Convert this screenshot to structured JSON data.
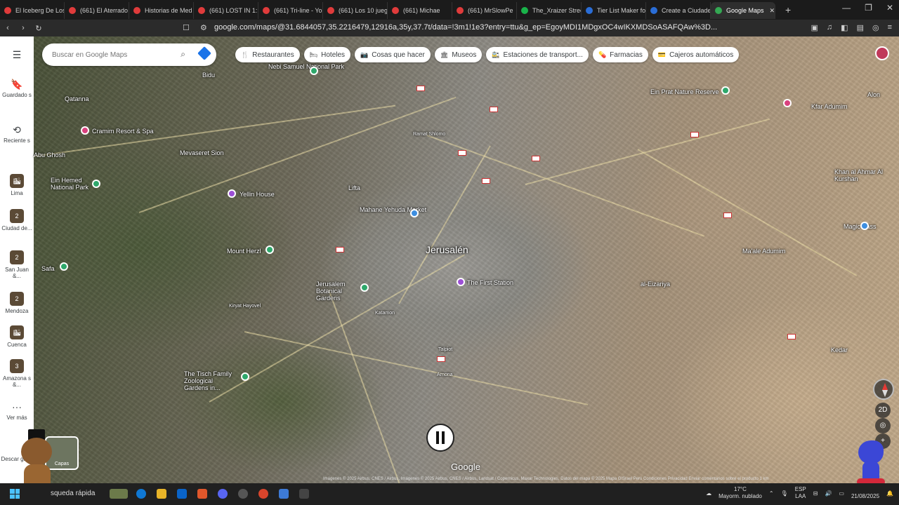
{
  "browser": {
    "tabs": [
      {
        "label": "El Iceberg De Los",
        "color": "#e03b3b"
      },
      {
        "label": "(661) El Aterrado",
        "color": "#e03b3b"
      },
      {
        "label": "Historias de Med",
        "color": "#e03b3b"
      },
      {
        "label": "(661) LOST IN 1:",
        "color": "#e03b3b"
      },
      {
        "label": "(661) Tri-line - Yo",
        "color": "#e03b3b"
      },
      {
        "label": "(661) Los 10 juegc",
        "color": "#e03b3b"
      },
      {
        "label": "(661) Michae",
        "color": "#e03b3b"
      },
      {
        "label": "(661) MrSlowPe",
        "color": "#e03b3b"
      },
      {
        "label": "The_Xraizer Stree",
        "color": "#19b34a"
      },
      {
        "label": "Tier List Maker fo",
        "color": "#2a6dd6"
      },
      {
        "label": "Create a Ciudade",
        "color": "#2a6dd6"
      },
      {
        "label": "Google Maps",
        "color": "#34a853",
        "active": true
      }
    ],
    "new_tab": "+",
    "close_glyph": "✕",
    "window_controls": [
      "—",
      "❐",
      "✕"
    ],
    "url": "google.com/maps/@31.6844057,35.2216479,12916a,35y,37.7t/data=!3m1!1e3?entry=ttu&g_ep=EgoyMDI1MDgxOC4wIKXMDSoASAFQAw%3D...",
    "nav": {
      "back": "‹",
      "forward": "›",
      "reload": "↻"
    }
  },
  "rail": {
    "menu_icon": "☰",
    "items": [
      {
        "glyph": "🔖",
        "label": "Guardado s"
      },
      {
        "glyph": "⟲",
        "label": "Reciente s"
      },
      {
        "thumb": "🏙",
        "label": "Lima"
      },
      {
        "thumb": "2",
        "label": "Ciudad de..."
      },
      {
        "thumb": "2",
        "label": "San Juan &..."
      },
      {
        "thumb": "2",
        "label": "Mendoza"
      },
      {
        "thumb": "🏙",
        "label": "Cuenca"
      },
      {
        "thumb": "3",
        "label": "Amazona s &..."
      },
      {
        "glyph": "···",
        "label": "Ver más"
      },
      {
        "label": "Descar ga la"
      }
    ]
  },
  "search": {
    "placeholder": "Buscar en Google Maps"
  },
  "chips": [
    {
      "icon": "🍴",
      "label": "Restaurantes"
    },
    {
      "icon": "🛏",
      "label": "Hoteles"
    },
    {
      "icon": "📷",
      "label": "Cosas que hacer"
    },
    {
      "icon": "🏛",
      "label": "Museos"
    },
    {
      "icon": "🚉",
      "label": "Estaciones de transport..."
    },
    {
      "icon": "💊",
      "label": "Farmacias"
    },
    {
      "icon": "💳",
      "label": "Cajeros automáticos"
    }
  ],
  "map": {
    "city": "Jerusalén",
    "places": [
      "Bidu",
      "Qatanna",
      "Cramim Resort & Spa",
      "Mevaseret Sion",
      "Ein Hemed National Park",
      "Yellin House",
      "Lifta",
      "Mahane Yehuda Market",
      "Mount Herzl",
      "Jerusalem Botanical Gardens",
      "The First Station",
      "Safa",
      "The Tisch Family Zoological Gardens in...",
      "Nebi Samuel National Park",
      "Ein Prat Nature Reserve",
      "Kfar Adumim",
      "Alon",
      "Khan al Ahmar Al Kurshan",
      "Ma'ale Adumim",
      "al-Eizariya",
      "Kedar",
      "Magic Kass",
      "Ramat Shlomo",
      "Abu Ghosh",
      "Kiryat Hayovel",
      "Katamon",
      "Talpiot",
      "Arnona"
    ],
    "layers_label": "Capas",
    "logo": "Google",
    "attribution": "Imágenes © 2025 Airbus, CNES / Airbus, Imágenes © 2025 Airbus, CNES / Airbus, Landsat / Copernicus, Maxar Technologies, Datos del mapa © 2025 Mapa GISrael   Perú   Condiciones   Privacidad   Enviar comentarios sobre el producto   1 km"
  },
  "taskbar": {
    "search_text": "squeda rápida",
    "weather": "17°C",
    "weather_desc": "Mayorm. nublado",
    "lang": "ESP",
    "lang2": "LAA",
    "time": "",
    "date": "21/08/2025"
  }
}
